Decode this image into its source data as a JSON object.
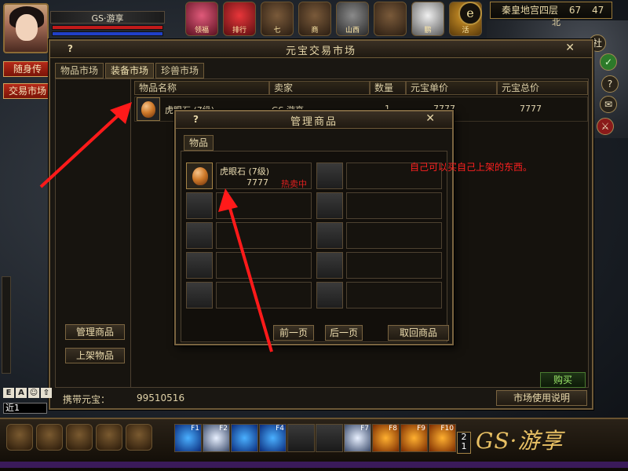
{
  "hud": {
    "player_name": "GS·游享",
    "location": "秦皇地宫四层",
    "coord_x": "67",
    "coord_y": "47",
    "north": "北",
    "mail_icon_text": "e",
    "side_buttons": [
      "随身传",
      "交易市场"
    ],
    "top_icons": [
      {
        "icon": "gift-icon",
        "label": "领福"
      },
      {
        "icon": "ranking-icon",
        "label": "排行"
      },
      {
        "icon": "battle-icon",
        "label": "七"
      },
      {
        "icon": "shop-icon",
        "label": "商"
      },
      {
        "icon": "castle-icon",
        "label": "山西"
      },
      {
        "icon": "map-icon",
        "label": ""
      },
      {
        "icon": "bird-icon",
        "label": "鹏"
      },
      {
        "icon": "arrow-icon",
        "label": "活"
      }
    ],
    "right_buttons": [
      "社",
      "?",
      "✉",
      "⚔"
    ],
    "chat_icons": [
      "E",
      "A",
      "☺",
      "⇧"
    ],
    "chat_input": "近1",
    "skills": [
      {
        "key": "F1",
        "style": "sk-blue"
      },
      {
        "key": "F2",
        "style": "sk-white"
      },
      {
        "key": "",
        "style": "sk-blue"
      },
      {
        "key": "F4",
        "style": "sk-blue"
      },
      {
        "key": "",
        "style": ""
      },
      {
        "key": "",
        "style": ""
      },
      {
        "key": "F7",
        "style": "sk-white"
      },
      {
        "key": "F8",
        "style": "sk-orange"
      },
      {
        "key": "F9",
        "style": "sk-orange"
      },
      {
        "key": "F10",
        "style": "sk-orange"
      }
    ],
    "logo_text": "GS·游享",
    "level_badge": "2 1"
  },
  "market": {
    "title": "元宝交易市场",
    "help": "?",
    "close": "✕",
    "tabs": [
      "物品市场",
      "装备市场",
      "珍兽市场"
    ],
    "active_tab": 1,
    "columns": [
      "物品名称",
      "卖家",
      "数量",
      "元宝单价",
      "元宝总价"
    ],
    "row": {
      "name": "虎眼石 (7级)",
      "seller": "GS·游享",
      "qty": "1",
      "unit_price": "7777",
      "total_price": "7777"
    },
    "left_buttons": [
      "管理商品",
      "上架物品"
    ],
    "buy_button": "购买",
    "carry_label": "携带元宝：",
    "carry_value": "99510516",
    "help_button": "市场使用说明"
  },
  "manage": {
    "title": "管理商品",
    "help": "?",
    "close": "✕",
    "tab": "物品",
    "item": {
      "name": "虎眼石 (7级)",
      "price": "7777",
      "status": "热卖中"
    },
    "buttons": [
      "前一页",
      "后一页",
      "取回商品"
    ]
  },
  "annotation": "自己可以买自己上架的东西。",
  "colors": {
    "status_red": "#e02020",
    "annotation_red": "#ff2020",
    "buy_green": "#9ce96a"
  }
}
